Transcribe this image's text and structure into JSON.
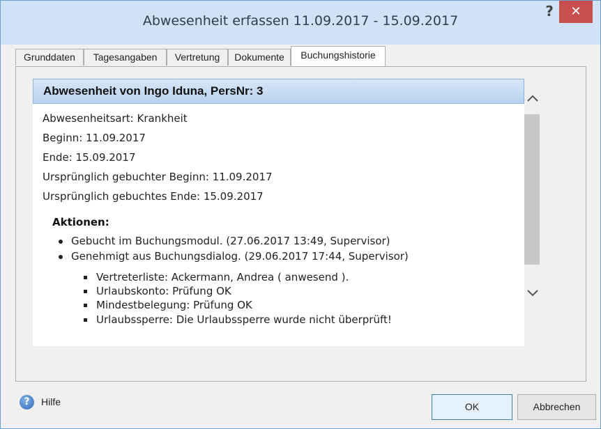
{
  "window": {
    "title": "Abwesenheit erfassen 11.09.2017 - 15.09.2017",
    "help_glyph": "?",
    "close_glyph": "✕"
  },
  "tabs": [
    {
      "label": "Grunddaten"
    },
    {
      "label": "Tagesangaben"
    },
    {
      "label": "Vertretung"
    },
    {
      "label": "Dokumente"
    },
    {
      "label": "Buchungshistorie",
      "active": true
    }
  ],
  "content": {
    "header": "Abwesenheit von Ingo Iduna, PersNr: 3",
    "lines": [
      "Abwesenheitsart: Krankheit",
      "Beginn: 11.09.2017",
      "Ende: 15.09.2017",
      "Ursprünglich gebuchter Beginn: 11.09.2017",
      "Ursprünglich gebuchtes Ende: 15.09.2017"
    ],
    "actions_title": "Aktionen:",
    "actions": [
      "Gebucht im Buchungsmodul. (27.06.2017 13:49, Supervisor)",
      "Genehmigt aus Buchungsdialog. (29.06.2017 17:44, Supervisor)"
    ],
    "subactions": [
      "Vertreterliste: Ackermann, Andrea ( anwesend ).",
      "Urlaubskonto: Prüfung OK",
      "Mindestbelegung: Prüfung OK",
      "Urlaubssperre: Die Urlaubssperre wurde nicht überprüft!"
    ]
  },
  "scroll": {
    "up_glyph": "^",
    "down_glyph": "v"
  },
  "footer": {
    "help_icon_glyph": "?",
    "help_label": "Hilfe",
    "ok_label": "OK",
    "cancel_label": "Abbrechen"
  },
  "colors": {
    "titlebar": "#cfe2f6",
    "close": "#c94f4f",
    "header_gradient_top": "#d8e7f7",
    "header_gradient_bottom": "#b8d1ee"
  }
}
